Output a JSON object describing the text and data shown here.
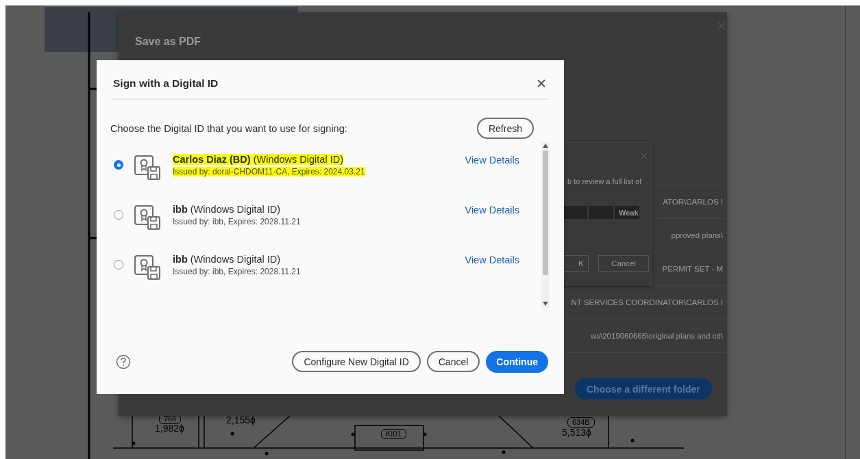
{
  "background": {
    "panel_title": "Save as PDF",
    "rows": [
      "ATOR\\CARLOS I",
      "pproved plans\\",
      "PERMIT SET - M",
      "NT SERVICES COORDINATOR\\CARLOS I",
      "ws\\2019060665\\original plans and cd\\"
    ],
    "folder_button": "Choose a different folder",
    "password_dialog": {
      "text": "b to review a full list of",
      "strength": "Weak",
      "ok": "K",
      "cancel": "Cancel"
    },
    "drawing_labels": [
      "766",
      "1,982ɸ",
      "2,155ɸ",
      "KI01",
      "634B",
      "5,513ɸ"
    ]
  },
  "dialog": {
    "title": "Sign with a Digital ID",
    "prompt": "Choose the Digital ID that you want to use for signing:",
    "refresh": "Refresh",
    "ids": [
      {
        "name": "Carlos Diaz (BD)",
        "type": "(Windows Digital ID)",
        "issuer": "Issued by: doral-CHDOM11-CA, Expires: 2024.03.21",
        "link": "View Details",
        "selected": true,
        "highlighted": true
      },
      {
        "name": "ibb",
        "type": "(Windows Digital ID)",
        "issuer": "Issued by: ibb, Expires: 2028.11.21",
        "link": "View Details",
        "selected": false,
        "highlighted": false
      },
      {
        "name": "ibb",
        "type": "(Windows Digital ID)",
        "issuer": "Issued by: ibb, Expires: 2028.11.21",
        "link": "View Details",
        "selected": false,
        "highlighted": false
      }
    ],
    "buttons": {
      "configure": "Configure New Digital ID",
      "cancel": "Cancel",
      "continue": "Continue"
    }
  }
}
